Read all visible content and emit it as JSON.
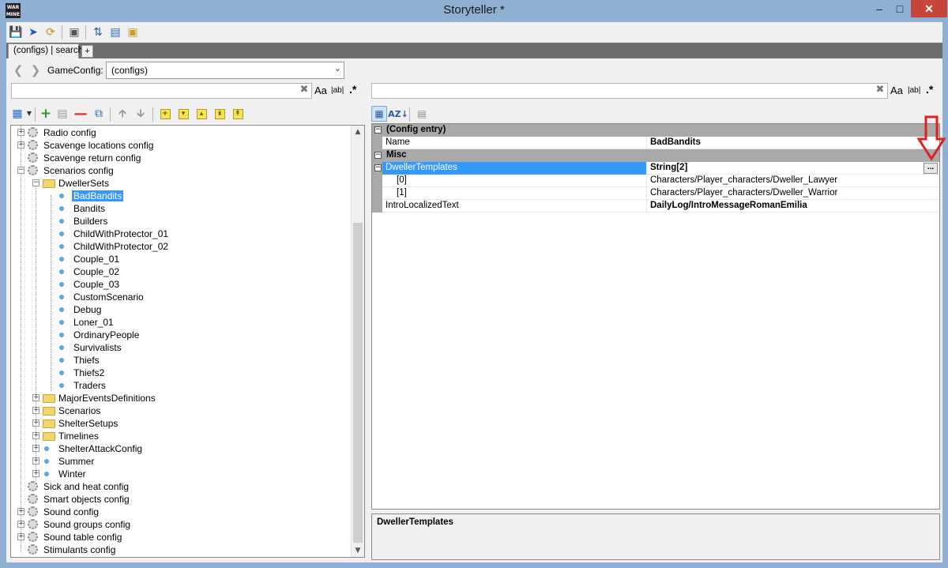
{
  "window": {
    "title": "Storyteller *",
    "app_icon_text": "WAR MINE"
  },
  "toolbar": {
    "icons": [
      "save-icon",
      "play-icon",
      "refresh-icon",
      "preview-icon",
      "sort-updown-icon",
      "list-view-icon",
      "folder-icon"
    ]
  },
  "tabs": [
    {
      "label": "(configs) | search"
    }
  ],
  "tab_add_label": "+",
  "nav": {
    "label": "GameConfig:",
    "combo_value": "(configs)"
  },
  "search": {
    "left": {
      "value": "",
      "opt_case": "Aa",
      "opt_word": "|ab|",
      "opt_regex": ".*"
    },
    "right": {
      "value": "",
      "opt_case": "Aa",
      "opt_word": "|ab|",
      "opt_regex": ".*"
    }
  },
  "tree": {
    "items": [
      {
        "label": "Radio config",
        "icon": "gear-icon",
        "expandable": true,
        "expanded": false,
        "level": 0
      },
      {
        "label": "Scavenge locations config",
        "icon": "gear-icon",
        "expandable": true,
        "expanded": false,
        "level": 0
      },
      {
        "label": "Scavenge return config",
        "icon": "gear-icon",
        "expandable": false,
        "level": 0
      },
      {
        "label": "Scenarios config",
        "icon": "gear-icon",
        "expandable": true,
        "expanded": true,
        "level": 0
      },
      {
        "label": "DwellerSets",
        "icon": "folder-icon",
        "expandable": true,
        "expanded": true,
        "level": 1
      },
      {
        "label": "BadBandits",
        "icon": "dot-icon",
        "expandable": false,
        "level": 2,
        "selected": true
      },
      {
        "label": "Bandits",
        "icon": "dot-icon",
        "expandable": false,
        "level": 2
      },
      {
        "label": "Builders",
        "icon": "dot-icon",
        "expandable": false,
        "level": 2
      },
      {
        "label": "ChildWithProtector_01",
        "icon": "dot-icon",
        "expandable": false,
        "level": 2
      },
      {
        "label": "ChildWithProtector_02",
        "icon": "dot-icon",
        "expandable": false,
        "level": 2
      },
      {
        "label": "Couple_01",
        "icon": "dot-icon",
        "expandable": false,
        "level": 2
      },
      {
        "label": "Couple_02",
        "icon": "dot-icon",
        "expandable": false,
        "level": 2
      },
      {
        "label": "Couple_03",
        "icon": "dot-icon",
        "expandable": false,
        "level": 2
      },
      {
        "label": "CustomScenario",
        "icon": "dot-icon",
        "expandable": false,
        "level": 2
      },
      {
        "label": "Debug",
        "icon": "dot-icon",
        "expandable": false,
        "level": 2
      },
      {
        "label": "Loner_01",
        "icon": "dot-icon",
        "expandable": false,
        "level": 2
      },
      {
        "label": "OrdinaryPeople",
        "icon": "dot-icon",
        "expandable": false,
        "level": 2
      },
      {
        "label": "Survivalists",
        "icon": "dot-icon",
        "expandable": false,
        "level": 2
      },
      {
        "label": "Thiefs",
        "icon": "dot-icon",
        "expandable": false,
        "level": 2
      },
      {
        "label": "Thiefs2",
        "icon": "dot-icon",
        "expandable": false,
        "level": 2
      },
      {
        "label": "Traders",
        "icon": "dot-icon",
        "expandable": false,
        "level": 2
      },
      {
        "label": "MajorEventsDefinitions",
        "icon": "folder-icon",
        "expandable": true,
        "expanded": false,
        "level": 1
      },
      {
        "label": "Scenarios",
        "icon": "folder-icon",
        "expandable": true,
        "expanded": false,
        "level": 1
      },
      {
        "label": "ShelterSetups",
        "icon": "folder-icon",
        "expandable": true,
        "expanded": false,
        "level": 1
      },
      {
        "label": "Timelines",
        "icon": "folder-icon",
        "expandable": true,
        "expanded": false,
        "level": 1
      },
      {
        "label": "ShelterAttackConfig",
        "icon": "dot-icon",
        "expandable": true,
        "expanded": false,
        "level": 1
      },
      {
        "label": "Summer",
        "icon": "dot-icon",
        "expandable": true,
        "expanded": false,
        "level": 1
      },
      {
        "label": "Winter",
        "icon": "dot-icon",
        "expandable": true,
        "expanded": false,
        "level": 1
      },
      {
        "label": "Sick and heat config",
        "icon": "gear-icon",
        "expandable": false,
        "level": 0
      },
      {
        "label": "Smart objects config",
        "icon": "gear-icon",
        "expandable": false,
        "level": 0
      },
      {
        "label": "Sound config",
        "icon": "gear-icon",
        "expandable": true,
        "expanded": false,
        "level": 0
      },
      {
        "label": "Sound groups config",
        "icon": "gear-icon",
        "expandable": true,
        "expanded": false,
        "level": 0
      },
      {
        "label": "Sound table config",
        "icon": "gear-icon",
        "expandable": true,
        "expanded": false,
        "level": 0
      },
      {
        "label": "Stimulants config",
        "icon": "gear-icon",
        "expandable": false,
        "level": 0
      }
    ]
  },
  "grid": {
    "categories": [
      {
        "label": "(Config entry)",
        "rows": [
          {
            "name": "Name",
            "value": "BadBandits",
            "bold": true
          }
        ]
      },
      {
        "label": "Misc",
        "rows": [
          {
            "name": "DwellerTemplates",
            "value": "String[2]",
            "bold": true,
            "selected": true,
            "expandable": true,
            "has_button": true,
            "button_label": "..."
          },
          {
            "name": "[0]",
            "value": "Characters/Player_characters/Dweller_Lawyer",
            "bold": false,
            "indent": true
          },
          {
            "name": "[1]",
            "value": "Characters/Player_characters/Dweller_Warrior",
            "bold": false,
            "indent": true
          },
          {
            "name": "IntroLocalizedText",
            "value": "DailyLog/IntroMessageRomanEmilia",
            "bold": true
          }
        ]
      }
    ]
  },
  "description": {
    "title": "DwellerTemplates"
  },
  "colors": {
    "selection": "#3399ff",
    "title_bar": "#8fb0d4",
    "close_button": "#c7453a",
    "annotation_arrow": "#e02020"
  }
}
